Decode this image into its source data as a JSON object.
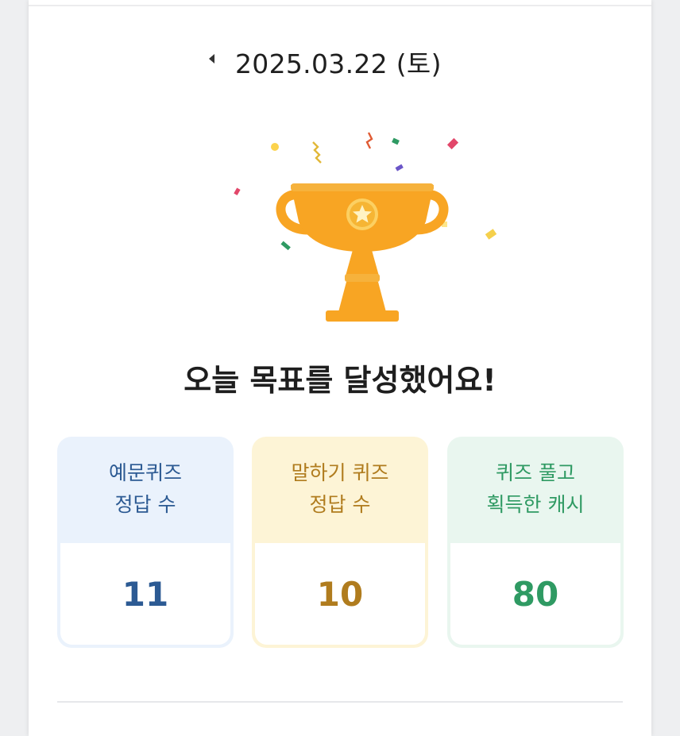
{
  "date_nav": {
    "date": "2025.03.22 (토)"
  },
  "headline": "오늘 목표를 달성했어요!",
  "cards": [
    {
      "line1": "예문퀴즈",
      "line2": "정답 수",
      "value": "11",
      "accent": "#2c5a93"
    },
    {
      "line1": "말하기 퀴즈",
      "line2": "정답 수",
      "value": "10",
      "accent": "#b07c1e"
    },
    {
      "line1": "퀴즈 풀고",
      "line2": "획득한 캐시",
      "value": "80",
      "accent": "#2f9a63"
    }
  ],
  "colors": {
    "trophy": "#f8a523",
    "trophy_highlight": "#fcd062",
    "background": "#ffffff"
  },
  "icons": {
    "prev": "chevron-left-icon",
    "trophy": "trophy-icon",
    "confetti": "confetti-icon"
  }
}
